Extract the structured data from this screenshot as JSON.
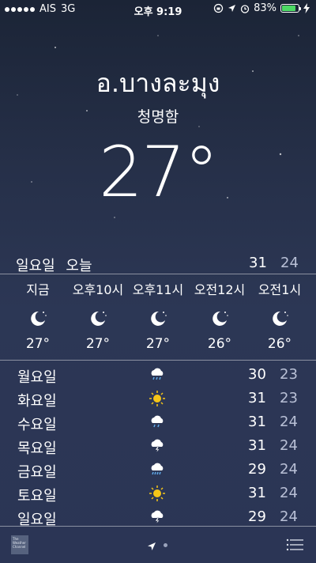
{
  "status_bar": {
    "carrier": "AIS",
    "network": "3G",
    "time": "오후 9:19",
    "battery": "83%",
    "battery_level": 0.83
  },
  "location": {
    "city": "อ.บางละมุง",
    "condition": "청명함",
    "temperature": "27°"
  },
  "today": {
    "day": "일요일",
    "label": "오늘",
    "high": "31",
    "low": "24"
  },
  "hourly": [
    {
      "time": "지금",
      "icon": "moon-stars-icon",
      "temp": "27°"
    },
    {
      "time": "오후10시",
      "icon": "moon-stars-icon",
      "temp": "27°"
    },
    {
      "time": "오후11시",
      "icon": "moon-stars-icon",
      "temp": "27°"
    },
    {
      "time": "오전12시",
      "icon": "moon-stars-icon",
      "temp": "26°"
    },
    {
      "time": "오전1시",
      "icon": "moon-stars-icon",
      "temp": "26°"
    }
  ],
  "daily": [
    {
      "day": "월요일",
      "icon": "rain-cloud-icon",
      "high": "30",
      "low": "23"
    },
    {
      "day": "화요일",
      "icon": "sun-icon",
      "high": "31",
      "low": "23"
    },
    {
      "day": "수요일",
      "icon": "rain-cloud-icon",
      "high": "31",
      "low": "24"
    },
    {
      "day": "목요일",
      "icon": "thunderstorm-icon",
      "high": "31",
      "low": "24"
    },
    {
      "day": "금요일",
      "icon": "rain-cloud-icon",
      "high": "29",
      "low": "24"
    },
    {
      "day": "토요일",
      "icon": "sun-icon",
      "high": "31",
      "low": "24"
    },
    {
      "day": "일요일",
      "icon": "thunderstorm-icon",
      "high": "29",
      "low": "24"
    }
  ],
  "bottom_bar": {
    "logo_text": "The Weather Channel"
  },
  "colors": {
    "background_top": "#1b2436",
    "background_bottom": "#2b3555",
    "low_temp": "#b9c0d6",
    "battery": "#4cd964",
    "sun": "#f5c518"
  }
}
